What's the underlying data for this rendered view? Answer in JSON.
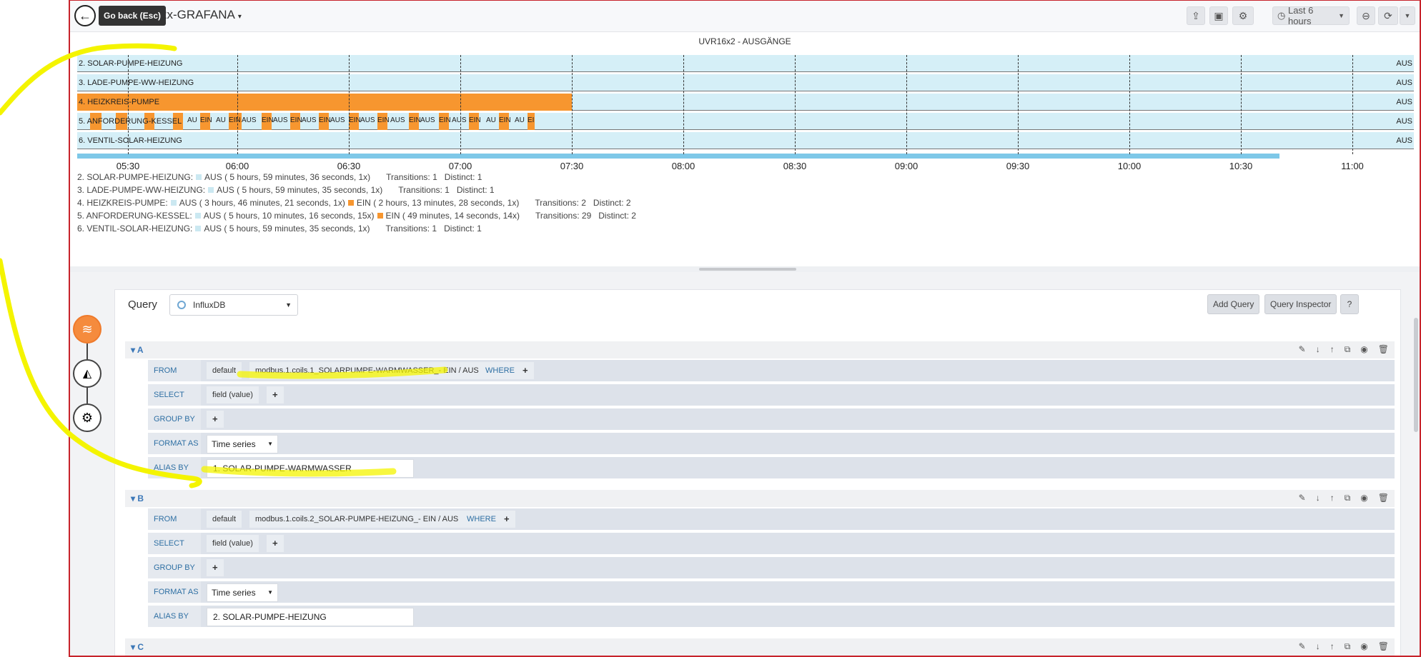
{
  "topbar": {
    "back_tooltip": "Go back (Esc)",
    "dashboard_title": "2x-GRAFANA",
    "dashboard_title_caret": "▾",
    "timepicker_label": "Last 6 hours",
    "icons": [
      "share-icon",
      "save-icon",
      "settings-icon",
      "clock-icon",
      "zoom-out-icon",
      "refresh-icon",
      "caret-icon"
    ]
  },
  "panel": {
    "title": "UVR16x2 - AUSGÄNGE",
    "rows": [
      {
        "label": "2. SOLAR-PUMPE-HEIZUNG",
        "end_value": "AUS"
      },
      {
        "label": "3. LADE-PUMPE-WW-HEIZUNG",
        "end_value": "AUS"
      },
      {
        "label": "4. HEIZKREIS-PUMPE",
        "end_value": "AUS"
      },
      {
        "label": "5. ANFORDERUNG-KESSEL",
        "end_value": "AUS"
      },
      {
        "label": "6. VENTIL-SOLAR-HEIZUNG",
        "end_value": "AUS"
      }
    ],
    "segment_labels": {
      "aus": "AUS",
      "ein": "EIN",
      "ein_short": "EI",
      "au_short": "AU"
    },
    "x_ticks": [
      "05:30",
      "06:00",
      "06:30",
      "07:00",
      "07:30",
      "08:00",
      "08:30",
      "09:00",
      "09:30",
      "10:00",
      "10:30",
      "11:00"
    ],
    "legend": [
      {
        "name": "2. SOLAR-PUMPE-HEIZUNG:",
        "items": [
          {
            "state": "AUS",
            "detail": "( 5 hours, 59 minutes, 36 seconds, 1x)"
          }
        ],
        "transitions": "Transitions: 1",
        "distinct": "Distinct: 1"
      },
      {
        "name": "3. LADE-PUMPE-WW-HEIZUNG:",
        "items": [
          {
            "state": "AUS",
            "detail": "( 5 hours, 59 minutes, 35 seconds, 1x)"
          }
        ],
        "transitions": "Transitions: 1",
        "distinct": "Distinct: 1"
      },
      {
        "name": "4. HEIZKREIS-PUMPE:",
        "items": [
          {
            "state": "AUS",
            "detail": "( 3 hours, 46 minutes, 21 seconds, 1x)"
          },
          {
            "state": "EIN",
            "detail": "( 2 hours, 13 minutes, 28 seconds, 1x)"
          }
        ],
        "transitions": "Transitions: 2",
        "distinct": "Distinct: 2"
      },
      {
        "name": "5. ANFORDERUNG-KESSEL:",
        "items": [
          {
            "state": "AUS",
            "detail": "( 5 hours, 10 minutes, 16 seconds, 15x)"
          },
          {
            "state": "EIN",
            "detail": "( 49 minutes, 14 seconds, 14x)"
          }
        ],
        "transitions": "Transitions: 29",
        "distinct": "Distinct: 2"
      },
      {
        "name": "6. VENTIL-SOLAR-HEIZUNG:",
        "items": [
          {
            "state": "AUS",
            "detail": "( 5 hours, 59 minutes, 35 seconds, 1x)"
          }
        ],
        "transitions": "Transitions: 1",
        "distinct": "Distinct: 1"
      }
    ],
    "colors": {
      "aus": "#d5eff7",
      "ein": "#f7962f"
    }
  },
  "query_editor": {
    "label": "Query",
    "datasource": "InfluxDB",
    "add_query": "Add Query",
    "query_inspector": "Query Inspector",
    "help": "?",
    "keys": {
      "from": "FROM",
      "select": "SELECT",
      "group_by": "GROUP BY",
      "format_as": "FORMAT AS",
      "alias_by": "ALIAS BY",
      "where": "WHERE",
      "plus": "+"
    },
    "queries": [
      {
        "letter": "A",
        "policy": "default",
        "measurement": "modbus.1.coils.1_SOLARPUMPE-WARMWASSER_- EIN / AUS",
        "select": "field (value)",
        "format": "Time series",
        "alias": "1. SOLAR-PUMPE-WARMWASSER"
      },
      {
        "letter": "B",
        "policy": "default",
        "measurement": "modbus.1.coils.2_SOLAR-PUMPE-HEIZUNG_- EIN / AUS",
        "select": "field (value)",
        "format": "Time series",
        "alias": "2. SOLAR-PUMPE-HEIZUNG"
      },
      {
        "letter": "C"
      }
    ],
    "row_tools": [
      "edit-icon",
      "move-down-icon",
      "move-up-icon",
      "duplicate-icon",
      "toggle-visibility-icon",
      "delete-icon"
    ]
  },
  "annotation_color": "#f4f400"
}
